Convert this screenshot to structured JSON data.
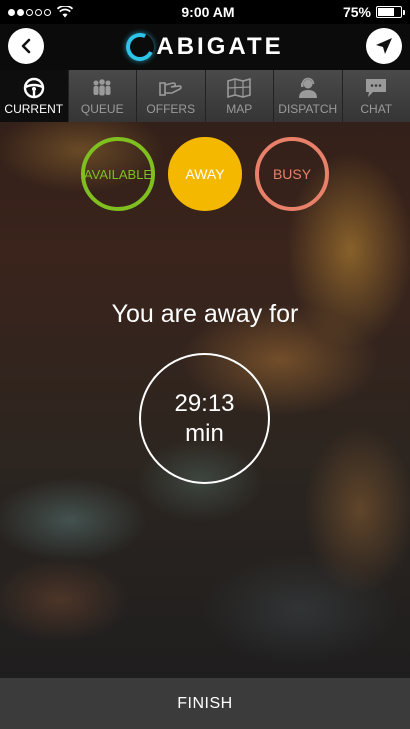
{
  "status_bar": {
    "time": "9:00 AM",
    "battery": "75%",
    "battery_level": 0.75,
    "signal_bars_on": 2,
    "signal_bars_total": 5
  },
  "header": {
    "logo_text": "ABIGATE",
    "back_icon": "chevron-left-icon",
    "nav_icon": "navigation-arrow-icon"
  },
  "tabs": [
    {
      "label": "CURRENT",
      "icon": "steering-wheel-icon",
      "active": true
    },
    {
      "label": "QUEUE",
      "icon": "people-group-icon",
      "active": false
    },
    {
      "label": "OFFERS",
      "icon": "hand-offer-icon",
      "active": false
    },
    {
      "label": "MAP",
      "icon": "map-icon",
      "active": false
    },
    {
      "label": "DISPATCH",
      "icon": "dispatcher-icon",
      "active": false
    },
    {
      "label": "CHAT",
      "icon": "chat-bubble-icon",
      "active": false
    }
  ],
  "status_toggles": {
    "available": "AVAILABLE",
    "away": "AWAY",
    "busy": "BUSY",
    "selected": "AWAY"
  },
  "away": {
    "label": "You are away for",
    "time": "29:13",
    "unit": "min"
  },
  "finish_label": "FINISH",
  "colors": {
    "available": "#7fbf1f",
    "away": "#f5b800",
    "busy": "#e9806a",
    "logo_accent": "#2ec4e8"
  }
}
